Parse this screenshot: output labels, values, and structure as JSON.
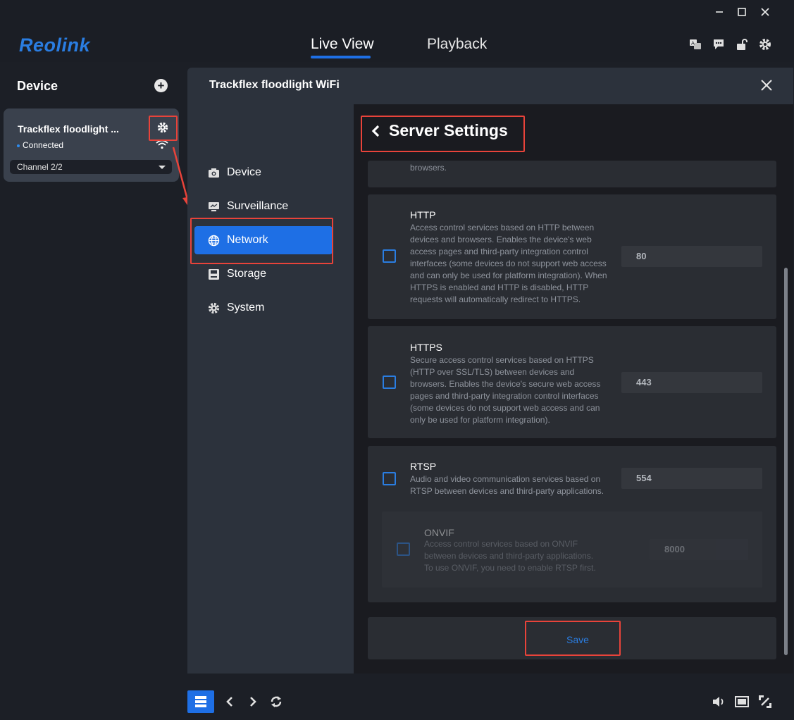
{
  "app": {
    "logo": "Reolink",
    "window_controls": {
      "minimize": "—",
      "maximize": "☐",
      "close": "✕"
    }
  },
  "header": {
    "tabs": [
      {
        "label": "Live View",
        "active": true
      },
      {
        "label": "Playback",
        "active": false
      }
    ],
    "icons": [
      "translate-icon",
      "message-icon",
      "unlock-icon",
      "gear-icon"
    ]
  },
  "sidebar": {
    "title": "Device",
    "device": {
      "name": "Trackflex floodlight ...",
      "status": "Connected",
      "channel": "Channel 2/2"
    }
  },
  "modal": {
    "title": "Trackflex floodlight WiFi",
    "nav": [
      {
        "label": "Device",
        "icon": "camera-icon",
        "active": false
      },
      {
        "label": "Surveillance",
        "icon": "monitor-icon",
        "active": false
      },
      {
        "label": "Network",
        "icon": "globe-icon",
        "active": true
      },
      {
        "label": "Storage",
        "icon": "disk-icon",
        "active": false
      },
      {
        "label": "System",
        "icon": "gear-icon",
        "active": false
      }
    ],
    "page_title": "Server Settings",
    "partial_text": "browsers.",
    "services": [
      {
        "name": "HTTP",
        "description": "Access control services based on HTTP between devices and browsers. Enables the device's web access pages and third-party integration control interfaces (some devices do not support web access and can only be used for platform integration). When HTTPS is enabled and HTTP is disabled, HTTP requests will automatically redirect to HTTPS.",
        "port": "80",
        "checked": false
      },
      {
        "name": "HTTPS",
        "description": "Secure access control services based on HTTPS (HTTP over SSL/TLS) between devices and browsers. Enables the device's secure web access pages and third-party integration control interfaces (some devices do not support web access and can only be used for platform integration).",
        "port": "443",
        "checked": false
      },
      {
        "name": "RTSP",
        "description": "Audio and video communication services based on RTSP between devices and third-party applications.",
        "port": "554",
        "checked": false
      }
    ],
    "onvif": {
      "name": "ONVIF",
      "description": "Access control services based on ONVIF between devices and third-party applications. To use ONVIF, you need to enable RTSP first.",
      "port": "8000",
      "disabled": true
    },
    "save_label": "Save"
  },
  "colors": {
    "accent": "#1e6fe5",
    "highlight": "#e8433a",
    "background": "#1c1f26"
  }
}
